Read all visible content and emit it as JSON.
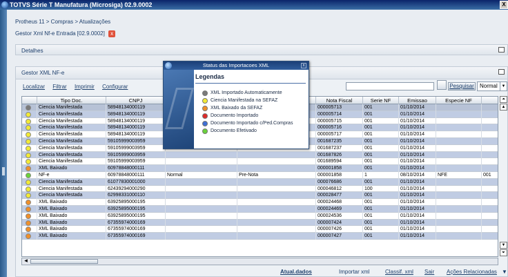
{
  "window": {
    "title": "TOTVS Série T Manufatura (Microsiga) 02.9.0002",
    "close_label": "X"
  },
  "breadcrumb": "Protheus 11 > Compras > Atualizações",
  "doc_tab": {
    "label": "Gestor Xml Nf-e Entrada [02.9.0002]",
    "close_label": "x"
  },
  "detalhes": {
    "title": "Detalhes"
  },
  "gestor": {
    "title": "Gestor XML NF-e"
  },
  "toolbar": {
    "links": [
      "Localizar",
      "Filtrar",
      "Imprimir",
      "Configurar"
    ],
    "search_button": "Pesquisar",
    "mode_value": "Normal"
  },
  "colors": {
    "gray": "#7a7a7a",
    "yellow": "#f2ea36",
    "orange": "#f0902a",
    "red": "#e02828",
    "blue": "#3f6fd6",
    "green": "#6ad23a"
  },
  "table": {
    "headers": [
      "",
      "Tipo Doc.",
      "CNPJ",
      "",
      "",
      "Nota Fiscal",
      "Serie NF",
      "Emissao",
      "Especie NF",
      ""
    ],
    "rows": [
      {
        "status": "gray",
        "tipo": "Ciencia Manifestada",
        "cnpj": "58948134000119",
        "c3": "",
        "c4": "",
        "nf": "000005713",
        "serie": "001",
        "emissao": "01/10/2014",
        "especie": "",
        "c9": ""
      },
      {
        "status": "yellow",
        "tipo": "Ciencia Manifestada",
        "cnpj": "58948134000119",
        "c3": "",
        "c4": "",
        "nf": "000005714",
        "serie": "001",
        "emissao": "01/10/2014",
        "especie": "",
        "c9": ""
      },
      {
        "status": "yellow",
        "tipo": "Ciencia Manifestada",
        "cnpj": "58948134000119",
        "c3": "",
        "c4": "",
        "nf": "000005715",
        "serie": "001",
        "emissao": "01/10/2014",
        "especie": "",
        "c9": ""
      },
      {
        "status": "yellow",
        "tipo": "Ciencia Manifestada",
        "cnpj": "58948134000119",
        "c3": "",
        "c4": "",
        "nf": "000005716",
        "serie": "001",
        "emissao": "01/10/2014",
        "especie": "",
        "c9": ""
      },
      {
        "status": "yellow",
        "tipo": "Ciencia Manifestada",
        "cnpj": "58948134000119",
        "c3": "",
        "c4": "",
        "nf": "000005717",
        "serie": "001",
        "emissao": "01/10/2014",
        "especie": "",
        "c9": ""
      },
      {
        "status": "yellow",
        "tipo": "Ciencia Manifestada",
        "cnpj": "59105999003959",
        "c3": "",
        "c4": "",
        "nf": "001687235",
        "serie": "001",
        "emissao": "01/10/2014",
        "especie": "",
        "c9": ""
      },
      {
        "status": "yellow",
        "tipo": "Ciencia Manifestada",
        "cnpj": "59105999003959",
        "c3": "",
        "c4": "",
        "nf": "001687237",
        "serie": "001",
        "emissao": "01/10/2014",
        "especie": "",
        "c9": ""
      },
      {
        "status": "yellow",
        "tipo": "Ciencia Manifestada",
        "cnpj": "59105999003959",
        "c3": "",
        "c4": "",
        "nf": "001687826",
        "serie": "001",
        "emissao": "01/10/2014",
        "especie": "",
        "c9": ""
      },
      {
        "status": "yellow",
        "tipo": "Ciencia Manifestada",
        "cnpj": "59105999003959",
        "c3": "",
        "c4": "",
        "nf": "001689594",
        "serie": "001",
        "emissao": "01/10/2014",
        "especie": "",
        "c9": ""
      },
      {
        "status": "orange",
        "tipo": "XML Baixado",
        "cnpj": "60978848000111",
        "c3": "",
        "c4": "",
        "nf": "000001858",
        "serie": "001",
        "emissao": "01/10/2014",
        "especie": "",
        "c9": ""
      },
      {
        "status": "green",
        "tipo": "NF-e",
        "cnpj": "60978848000111",
        "c3": "Normal",
        "c4": "Pre-Nota",
        "nf": "000001858",
        "serie": "1",
        "emissao": "08/10/2014",
        "especie": "NFE",
        "c9": "001"
      },
      {
        "status": "yellow",
        "tipo": "Ciencia Manifestada",
        "cnpj": "61077830001000",
        "c3": "",
        "c4": "",
        "nf": "000076686",
        "serie": "001",
        "emissao": "01/10/2014",
        "especie": "",
        "c9": ""
      },
      {
        "status": "yellow",
        "tipo": "Ciencia Manifestada",
        "cnpj": "62439294000290",
        "c3": "",
        "c4": "",
        "nf": "000046812",
        "serie": "100",
        "emissao": "01/10/2014",
        "especie": "",
        "c9": ""
      },
      {
        "status": "yellow",
        "tipo": "Ciencia Manifestada",
        "cnpj": "62998331000110",
        "c3": "",
        "c4": "",
        "nf": "000028477",
        "serie": "001",
        "emissao": "01/10/2014",
        "especie": "",
        "c9": ""
      },
      {
        "status": "orange",
        "tipo": "XML Baixado",
        "cnpj": "63925895000195",
        "c3": "",
        "c4": "",
        "nf": "000024468",
        "serie": "001",
        "emissao": "01/10/2014",
        "especie": "",
        "c9": ""
      },
      {
        "status": "orange",
        "tipo": "XML Baixado",
        "cnpj": "63925895000195",
        "c3": "",
        "c4": "",
        "nf": "000024469",
        "serie": "001",
        "emissao": "01/10/2014",
        "especie": "",
        "c9": ""
      },
      {
        "status": "orange",
        "tipo": "XML Baixado",
        "cnpj": "63925895000195",
        "c3": "",
        "c4": "",
        "nf": "000024536",
        "serie": "001",
        "emissao": "01/10/2014",
        "especie": "",
        "c9": ""
      },
      {
        "status": "orange",
        "tipo": "XML Baixado",
        "cnpj": "67355974000169",
        "c3": "",
        "c4": "",
        "nf": "000007424",
        "serie": "001",
        "emissao": "01/10/2014",
        "especie": "",
        "c9": ""
      },
      {
        "status": "orange",
        "tipo": "XML Baixado",
        "cnpj": "67355974000169",
        "c3": "",
        "c4": "",
        "nf": "000007426",
        "serie": "001",
        "emissao": "01/10/2014",
        "especie": "",
        "c9": ""
      },
      {
        "status": "orange",
        "tipo": "XML Baixado",
        "cnpj": "67355974000169",
        "c3": "",
        "c4": "",
        "nf": "000007427",
        "serie": "001",
        "emissao": "01/10/2014",
        "especie": "",
        "c9": ""
      }
    ]
  },
  "footer": {
    "atualizar": "Atual.dados",
    "importar": "Importar xml",
    "classif": "Classif. xml",
    "sair": "Sair",
    "acoes": "Ações Relacionadas"
  },
  "modal": {
    "title": "Status das Importacoes XML",
    "close_label": "x",
    "heading": "Legendas",
    "items": [
      {
        "color": "gray",
        "label": "XML Importado Automaticamente"
      },
      {
        "color": "yellow",
        "label": "Ciencia Manifestada na SEFAZ"
      },
      {
        "color": "orange",
        "label": "XML Baixado da SEFAZ"
      },
      {
        "color": "red",
        "label": "Documento Importado"
      },
      {
        "color": "blue",
        "label": "Documento Importado c/Ped.Compras"
      },
      {
        "color": "green",
        "label": "Documento Efetivado"
      }
    ]
  }
}
